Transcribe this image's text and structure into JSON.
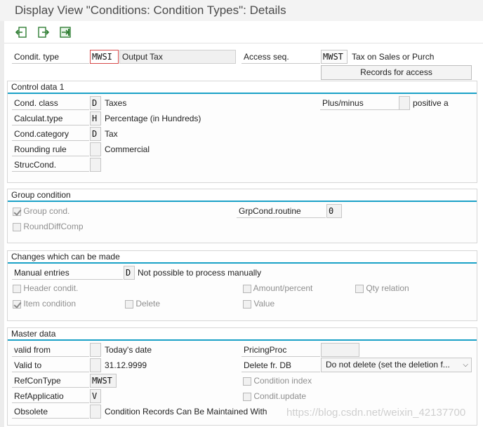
{
  "window": {
    "title": "Display View \"Conditions: Condition Types\": Details"
  },
  "toolbar": {
    "icons": [
      "previous-entry-icon",
      "next-entry-icon",
      "other-entry-icon"
    ]
  },
  "header": {
    "condit_type_label": "Condit. type",
    "condit_type_value": "MWSI",
    "condit_type_desc": "Output Tax",
    "access_seq_label": "Access seq.",
    "access_seq_value": "MWST",
    "access_seq_desc": "Tax on Sales or Purch",
    "records_button": "Records for access"
  },
  "control_data": {
    "title": "Control data 1",
    "cond_class_label": "Cond. class",
    "cond_class_value": "D",
    "cond_class_desc": "Taxes",
    "calc_type_label": "Calculat.type",
    "calc_type_value": "H",
    "calc_type_desc": "Percentage (in Hundreds)",
    "cond_category_label": "Cond.category",
    "cond_category_value": "D",
    "cond_category_desc": "Tax",
    "rounding_label": "Rounding rule",
    "rounding_value": "",
    "rounding_desc": "Commercial",
    "struc_cond_label": "StrucCond.",
    "struc_cond_value": "",
    "plus_minus_label": "Plus/minus",
    "plus_minus_value": "",
    "plus_minus_desc": "positive a"
  },
  "group_condition": {
    "title": "Group condition",
    "group_cond_label": "Group cond.",
    "group_cond_checked": true,
    "round_diff_label": "RoundDiffComp",
    "round_diff_checked": false,
    "grp_routine_label": "GrpCond.routine",
    "grp_routine_value": "0"
  },
  "changes": {
    "title": "Changes which can be made",
    "manual_entries_label": "Manual entries",
    "manual_entries_value": "D",
    "manual_entries_desc": "Not possible to process manually",
    "header_condit_label": "Header condit.",
    "amount_percent_label": "Amount/percent",
    "qty_relation_label": "Qty relation",
    "item_condition_label": "Item condition",
    "item_condition_checked": true,
    "delete_label": "Delete",
    "value_label": "Value"
  },
  "master_data": {
    "title": "Master data",
    "valid_from_label": "valid from",
    "valid_from_value": "",
    "valid_from_desc": "Today's date",
    "valid_to_label": "Valid to",
    "valid_to_value": "",
    "valid_to_desc": "31.12.9999",
    "ref_con_type_label": "RefConType",
    "ref_con_type_value": "MWST",
    "ref_application_label": "RefApplicatio",
    "ref_application_value": "V",
    "obsolete_label": "Obsolete",
    "obsolete_value": "",
    "obsolete_desc": "Condition Records Can Be Maintained With",
    "pricing_proc_label": "PricingProc",
    "pricing_proc_value": "",
    "delete_fr_db_label": "Delete fr. DB",
    "delete_fr_db_value": "Do not delete (set the deletion f...",
    "condition_index_label": "Condition index",
    "condit_update_label": "Condit.update"
  },
  "watermark": "https://blog.csdn.net/weixin_42137700"
}
